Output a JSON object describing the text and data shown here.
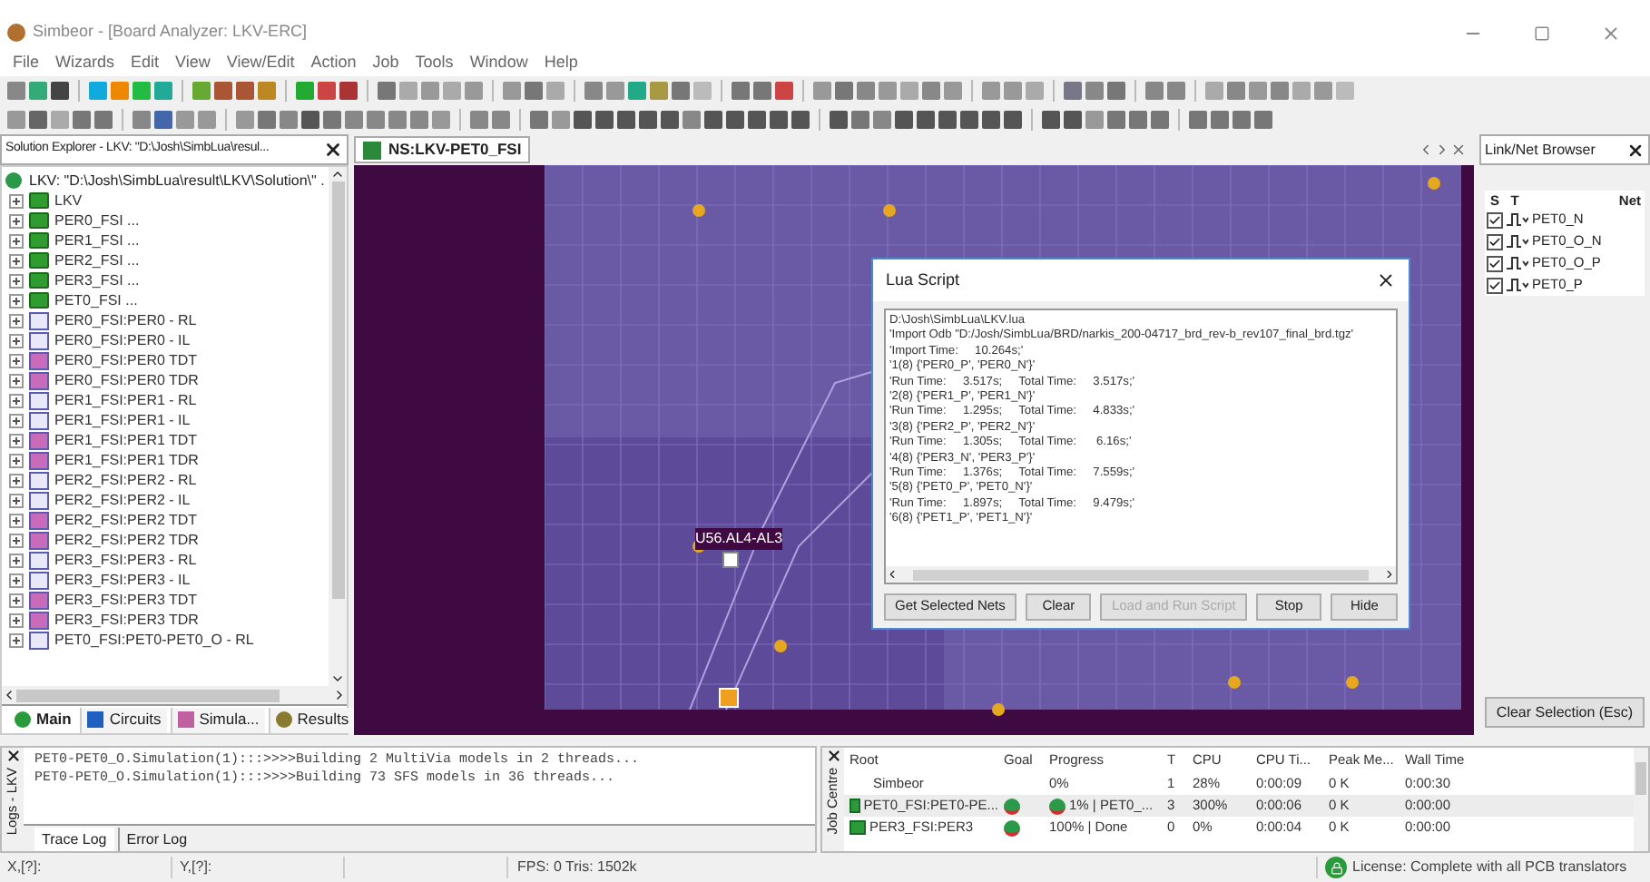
{
  "window": {
    "title": "Simbeor - [Board Analyzer: LKV-ERC]"
  },
  "menu": [
    "File",
    "Wizards",
    "Edit",
    "View",
    "View/Edit",
    "Action",
    "Job",
    "Tools",
    "Window",
    "Help"
  ],
  "solution_explorer": {
    "title": "Solution Explorer - LKV: \"D:\\Josh\\SimbLua\\resul...",
    "root": "LKV: \"D:\\Josh\\SimbLua\\result\\LKV\\Solution\\\" .",
    "items": [
      {
        "label": "LKV",
        "kind": "folder"
      },
      {
        "label": "PER0_FSI ...",
        "kind": "folder"
      },
      {
        "label": "PER1_FSI ...",
        "kind": "folder"
      },
      {
        "label": "PER2_FSI ...",
        "kind": "folder"
      },
      {
        "label": "PER3_FSI ...",
        "kind": "folder"
      },
      {
        "label": "PET0_FSI ...",
        "kind": "folder"
      },
      {
        "label": "PER0_FSI:PER0 - RL",
        "kind": "sparam"
      },
      {
        "label": "PER0_FSI:PER0 - IL",
        "kind": "sparam"
      },
      {
        "label": "PER0_FSI:PER0 TDT",
        "kind": "time"
      },
      {
        "label": "PER0_FSI:PER0 TDR",
        "kind": "time"
      },
      {
        "label": "PER1_FSI:PER1 - RL",
        "kind": "sparam"
      },
      {
        "label": "PER1_FSI:PER1 - IL",
        "kind": "sparam"
      },
      {
        "label": "PER1_FSI:PER1 TDT",
        "kind": "time"
      },
      {
        "label": "PER1_FSI:PER1 TDR",
        "kind": "time"
      },
      {
        "label": "PER2_FSI:PER2 - RL",
        "kind": "sparam"
      },
      {
        "label": "PER2_FSI:PER2 - IL",
        "kind": "sparam"
      },
      {
        "label": "PER2_FSI:PER2 TDT",
        "kind": "time"
      },
      {
        "label": "PER2_FSI:PER2 TDR",
        "kind": "time"
      },
      {
        "label": "PER3_FSI:PER3 - RL",
        "kind": "sparam"
      },
      {
        "label": "PER3_FSI:PER3 - IL",
        "kind": "sparam"
      },
      {
        "label": "PER3_FSI:PER3 TDT",
        "kind": "time"
      },
      {
        "label": "PER3_FSI:PER3 TDR",
        "kind": "time"
      },
      {
        "label": "PET0_FSI:PET0-PET0_O - RL",
        "kind": "sparam"
      }
    ],
    "tabs": [
      {
        "label": "Main",
        "selected": true,
        "kind": "main"
      },
      {
        "label": "Circuits",
        "selected": false,
        "kind": "circuits"
      },
      {
        "label": "Simula...",
        "selected": false,
        "kind": "sim"
      },
      {
        "label": "Results",
        "selected": false,
        "kind": "results"
      }
    ]
  },
  "document_tab": {
    "label": "NS:LKV-PET0_FSI"
  },
  "canvas": {
    "component_label": "U56.AL4-AL3"
  },
  "lua_dialog": {
    "title": "Lua Script",
    "lines": [
      "D:\\Josh\\SimbLua\\LKV.lua",
      "'Import Odb \"D:/Josh/SimbLua/BRD/narkis_200-04717_brd_rev-b_rev107_final_brd.tgz'",
      "'Import Time:     10.264s;'",
      "'1(8) {'PER0_P', 'PER0_N'}'",
      "'Run Time:     3.517s;     Total Time:     3.517s;'",
      "'2(8) {'PER1_P', 'PER1_N'}'",
      "'Run Time:     1.295s;     Total Time:     4.833s;'",
      "'3(8) {'PER2_P', 'PER2_N'}'",
      "'Run Time:     1.305s;     Total Time:      6.16s;'",
      "'4(8) {'PER3_N', 'PER3_P'}'",
      "'Run Time:     1.376s;     Total Time:     7.559s;'",
      "'5(8) {'PET0_P', 'PET0_N'}'",
      "'Run Time:     1.897s;     Total Time:     9.479s;'",
      "'6(8) {'PET1_P', 'PET1_N'}'"
    ],
    "buttons": [
      {
        "label": "Get Selected Nets",
        "disabled": false
      },
      {
        "label": "Clear",
        "disabled": false
      },
      {
        "label": "Load and Run Script",
        "disabled": true
      },
      {
        "label": "Stop",
        "disabled": false
      },
      {
        "label": "Hide",
        "disabled": false
      }
    ]
  },
  "net_browser": {
    "title": "Link/Net Browser",
    "columns": [
      "S",
      "T",
      "Net"
    ],
    "rows": [
      {
        "net": "PET0_N",
        "checked": true
      },
      {
        "net": "PET0_O_N",
        "checked": true
      },
      {
        "net": "PET0_O_P",
        "checked": true
      },
      {
        "net": "PET0_P",
        "checked": true
      }
    ],
    "button": "Clear Selection (Esc)"
  },
  "log": {
    "side_label": "Logs - LKV",
    "lines": [
      "PET0-PET0_O.Simulation(1):::>>>>Building 2 MultiVia models in 2 threads...",
      "PET0-PET0_O.Simulation(1):::>>>>Building 73 SFS models in 36 threads..."
    ],
    "tabs": [
      {
        "label": "Trace Log",
        "selected": true
      },
      {
        "label": "Error Log",
        "selected": false
      }
    ]
  },
  "job_centre": {
    "side_label": "Job Centre",
    "columns": [
      "Root",
      "Goal",
      "Progress",
      "T",
      "CPU",
      "CPU Ti...",
      "Peak Me...",
      "Wall Time"
    ],
    "rows": [
      {
        "kind": "root",
        "root": "Simbeor",
        "progress": "0%",
        "progress_icon": false,
        "t": "1",
        "cpu": "28%",
        "cpu_time": "0:00:09",
        "peak": "0 K",
        "wall": "0:00:30",
        "selected": false
      },
      {
        "kind": "task",
        "root": "PET0_FSI:PET0-PE...",
        "progress": "1% | PET0_...",
        "progress_icon": true,
        "t": "3",
        "cpu": "300%",
        "cpu_time": "0:00:06",
        "peak": "0 K",
        "wall": "0:00:00",
        "selected": true
      },
      {
        "kind": "task",
        "root": "PER3_FSI:PER3",
        "progress": "100% | Done",
        "progress_icon": false,
        "t": "0",
        "cpu": "0%",
        "cpu_time": "0:00:04",
        "peak": "0 K",
        "wall": "0:00:00",
        "selected": false
      }
    ]
  },
  "status_bar": {
    "x": "X,[?]:",
    "y": "Y,[?]:",
    "fps": "FPS: 0 Tris: 1502k",
    "license": "License: Complete with all PCB translators"
  }
}
